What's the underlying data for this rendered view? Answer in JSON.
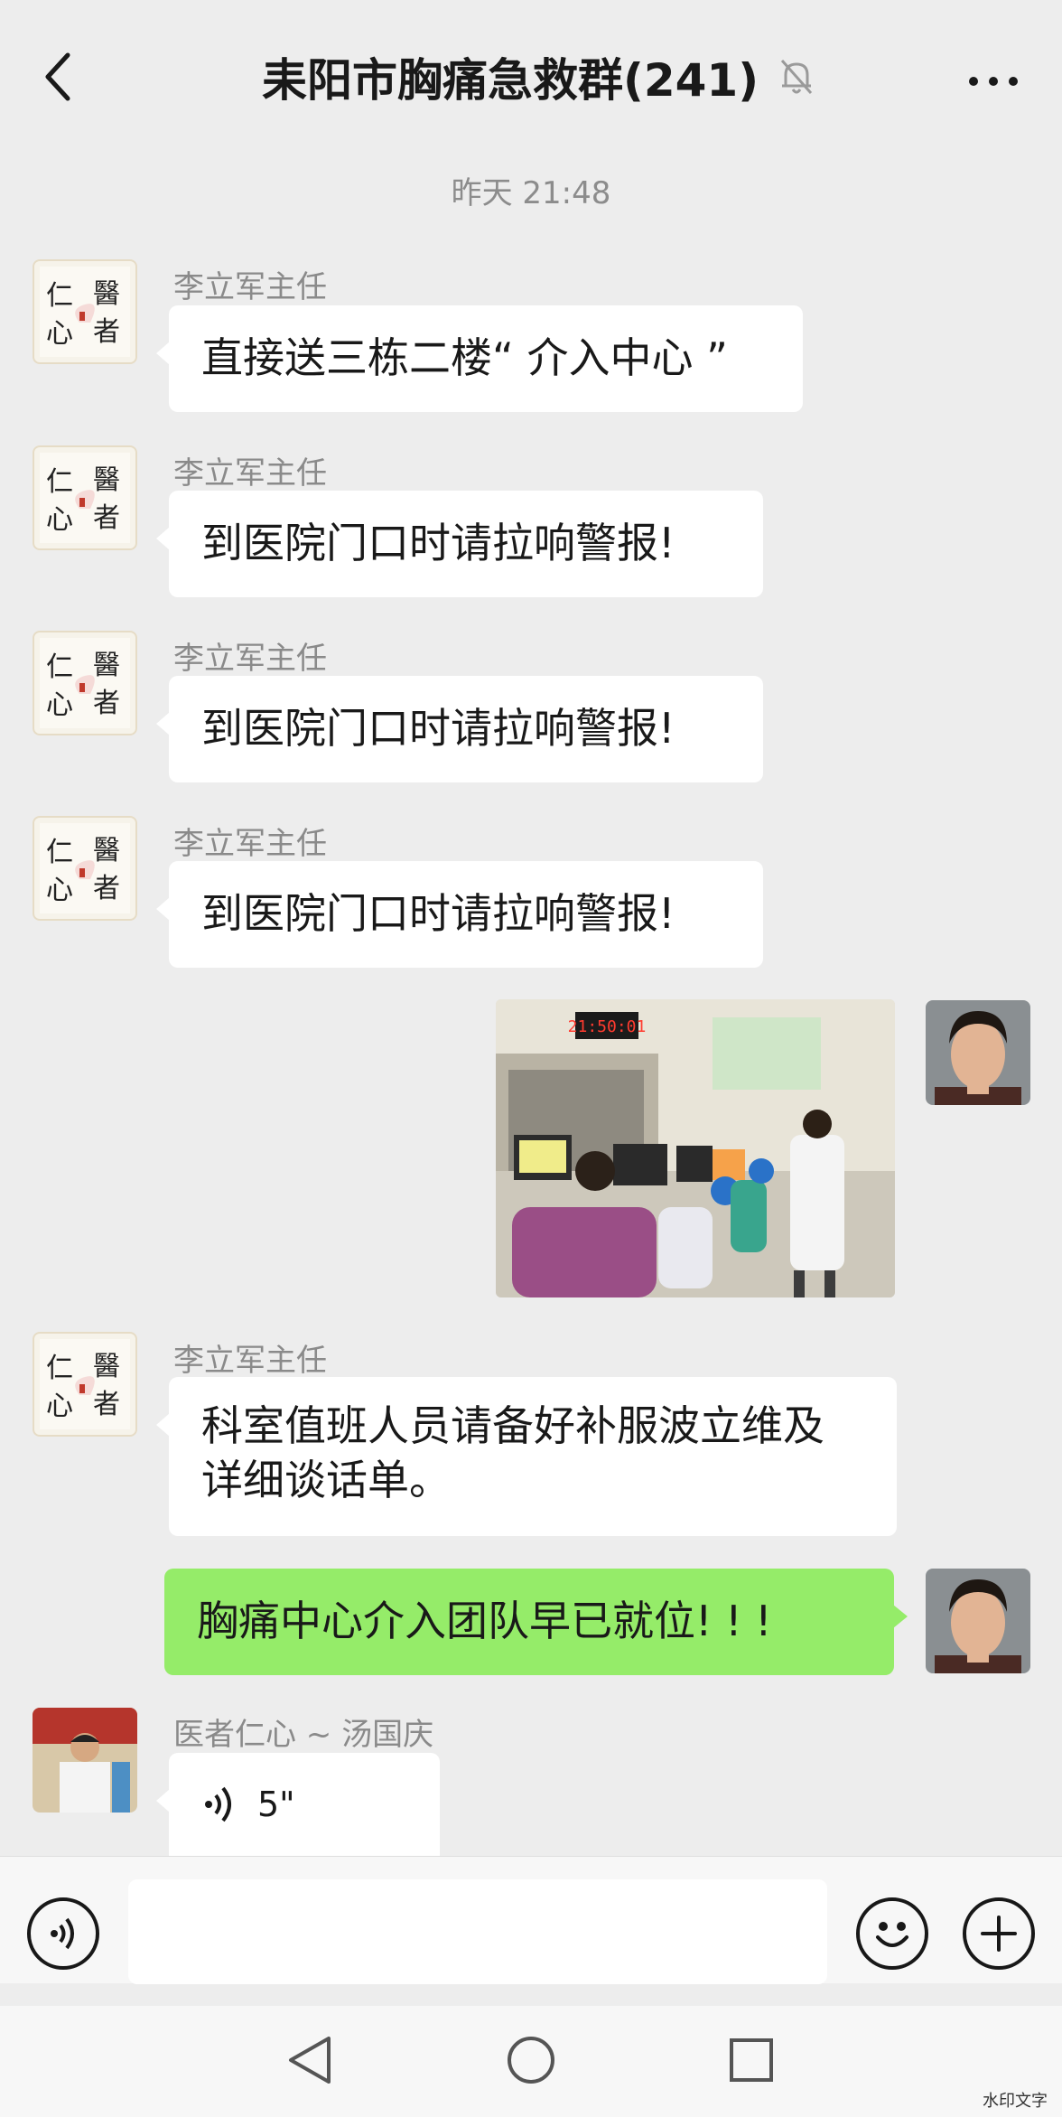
{
  "header": {
    "back_icon": "chevron-left-icon",
    "title": "耒阳市胸痛急救群(241)",
    "mute_icon": "bell-off-icon",
    "more_icon": "more-dots-icon"
  },
  "timestamp": "昨天 21:48",
  "messages": [
    {
      "sender": "李立军主任",
      "text": "直接送三栋二楼“ 介入中心 ”"
    },
    {
      "sender": "李立军主任",
      "text": "到医院门口时请拉响警报!"
    },
    {
      "sender": "李立军主任",
      "text": "到医院门口时请拉响警报!"
    },
    {
      "sender": "李立军主任",
      "text": "到医院门口时请拉响警报!"
    },
    {
      "type": "image",
      "clock": "21:50:01"
    },
    {
      "sender": "李立军主任",
      "line1": "科室值班人员请备好补服波立维及",
      "line2": "详细谈话单。"
    },
    {
      "self": true,
      "text": "胸痛中心介入团队早已就位! ! !"
    },
    {
      "sender": "医者仁心 ~ 汤国庆",
      "voice_duration": "5\""
    }
  ],
  "avatar_calligraphy": {
    "top_left": "仁",
    "bottom_left": "心",
    "top_right": "醫",
    "bottom_right": "者"
  },
  "composer": {
    "voice_icon": "voice-mode-icon",
    "emoji_icon": "emoji-icon",
    "plus_icon": "plus-icon"
  },
  "navbar": {
    "back_icon": "nav-back-icon",
    "home_icon": "nav-home-icon",
    "recents_icon": "nav-recents-icon"
  },
  "watermark": "水印文字"
}
